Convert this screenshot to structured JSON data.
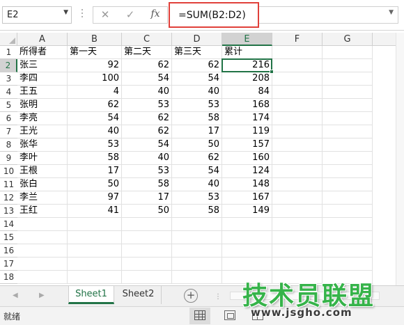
{
  "formula_bar": {
    "name_box": "E2",
    "cancel_symbol": "✕",
    "enter_symbol": "✓",
    "fx_label": "fx",
    "formula": "=SUM(B2:D2)"
  },
  "columns": [
    "A",
    "B",
    "C",
    "D",
    "E",
    "F",
    "G"
  ],
  "rows": [
    "1",
    "2",
    "3",
    "4",
    "5",
    "6",
    "7",
    "8",
    "9",
    "10",
    "11",
    "12",
    "13",
    "14",
    "15",
    "16",
    "17",
    "18"
  ],
  "active_cell": {
    "column": "E",
    "row": "2"
  },
  "table": {
    "headers": [
      "所得者",
      "第一天",
      "第二天",
      "第三天",
      "累计"
    ],
    "records": [
      [
        "张三",
        "92",
        "62",
        "62",
        "216"
      ],
      [
        "李四",
        "100",
        "54",
        "54",
        "208"
      ],
      [
        "王五",
        "4",
        "40",
        "40",
        "84"
      ],
      [
        "张明",
        "62",
        "53",
        "53",
        "168"
      ],
      [
        "李亮",
        "54",
        "62",
        "58",
        "174"
      ],
      [
        "王光",
        "40",
        "62",
        "17",
        "119"
      ],
      [
        "张华",
        "53",
        "54",
        "50",
        "157"
      ],
      [
        "李叶",
        "58",
        "40",
        "62",
        "160"
      ],
      [
        "王根",
        "17",
        "53",
        "54",
        "124"
      ],
      [
        "张白",
        "50",
        "58",
        "40",
        "148"
      ],
      [
        "李兰",
        "97",
        "17",
        "53",
        "167"
      ],
      [
        "王红",
        "41",
        "50",
        "58",
        "149"
      ]
    ]
  },
  "sheet_tabs": {
    "tabs": [
      "Sheet1",
      "Sheet2"
    ],
    "active": "Sheet1",
    "add_symbol": "+"
  },
  "status_bar": {
    "status": "就绪",
    "zoom_minus": "−"
  },
  "watermark": {
    "title": "技术员联盟",
    "url": "www.jsgho.com"
  },
  "colors": {
    "accent": "#217346",
    "formula_highlight": "#e0403a",
    "watermark_green": "#36b34a"
  }
}
